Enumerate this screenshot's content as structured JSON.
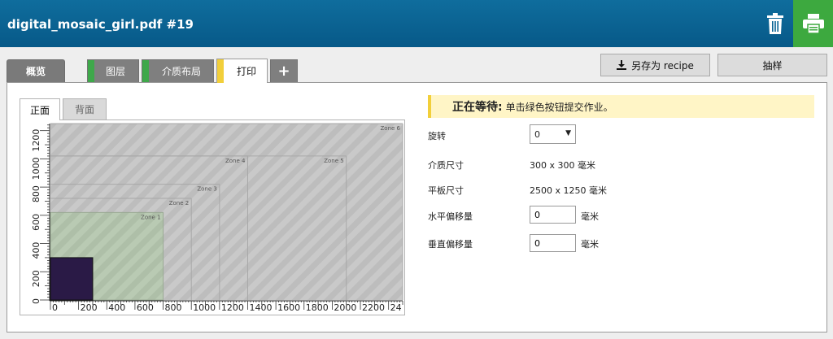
{
  "header": {
    "title": "digital_mosaic_girl.pdf #19"
  },
  "tabs": {
    "overview": "概览",
    "layers": "图层",
    "media_layout": "介质布局",
    "print": "打印",
    "add": "+"
  },
  "buttons": {
    "save_recipe": "另存为 recipe",
    "sample": "抽样"
  },
  "side_tabs": {
    "front": "正面",
    "back": "背面"
  },
  "status": {
    "label": "正在等待:",
    "message": "单击绿色按钮提交作业。"
  },
  "form": {
    "rotation_label": "旋转",
    "rotation_value": "0",
    "media_size_label": "介质尺寸",
    "media_size_value": "300 x 300 毫米",
    "table_size_label": "平板尺寸",
    "table_size_value": "2500 x 1250 毫米",
    "h_offset_label": "水平偏移量",
    "h_offset_value": "0",
    "h_offset_unit": "毫米",
    "v_offset_label": "垂直偏移量",
    "v_offset_value": "0",
    "v_offset_unit": "毫米"
  },
  "chart_data": {
    "type": "table",
    "x_ticks": [
      "0",
      "200",
      "400",
      "600",
      "800",
      "1000",
      "1200",
      "1400",
      "1600",
      "1800",
      "2000",
      "2200",
      "24"
    ],
    "y_ticks": [
      "0",
      "200",
      "400",
      "600",
      "800",
      "1000",
      "1200"
    ],
    "xlim": [
      0,
      2500
    ],
    "ylim": [
      0,
      1250
    ],
    "table_size_mm": [
      2500,
      1250
    ],
    "zones": [
      {
        "name": "Zone 1",
        "x": [
          0,
          800
        ],
        "y": [
          0,
          620
        ]
      },
      {
        "name": "Zone 2",
        "x": [
          0,
          1000
        ],
        "y": [
          0,
          720
        ]
      },
      {
        "name": "Zone 3",
        "x": [
          0,
          1200
        ],
        "y": [
          0,
          820
        ]
      },
      {
        "name": "Zone 4",
        "x": [
          0,
          1400
        ],
        "y": [
          0,
          1020
        ]
      },
      {
        "name": "Zone 5",
        "x": [
          0,
          2100
        ],
        "y": [
          0,
          1020
        ]
      },
      {
        "name": "Zone 6",
        "x": [
          0,
          2500
        ],
        "y": [
          0,
          1250
        ]
      }
    ],
    "media": {
      "x": [
        0,
        300
      ],
      "y": [
        0,
        300
      ]
    },
    "colors": {
      "zone1_fill": "#b7c9b0",
      "table_fill": "#c8c8c8",
      "media_fill": "#2a1a46"
    }
  },
  "colors": {
    "header": "#0a6494",
    "print_button": "#3da93f",
    "accent_yellow": "#f2cf3a",
    "status_bg": "#fff5c6"
  }
}
